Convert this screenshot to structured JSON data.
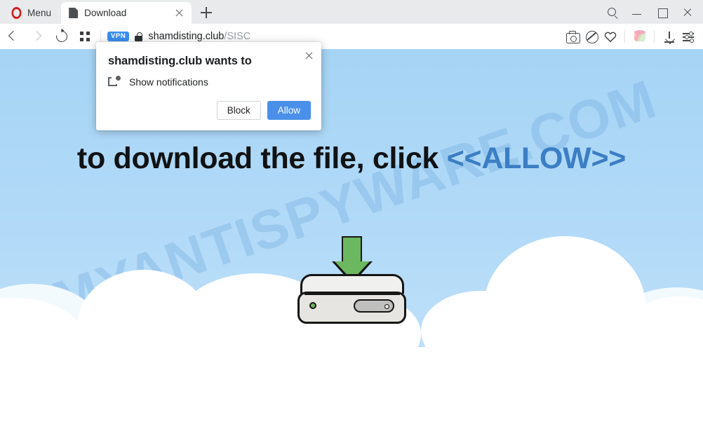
{
  "browser": {
    "menu_label": "Menu",
    "opera_logo_icon": "opera-logo-icon",
    "tab": {
      "title": "Download",
      "favicon": "page-icon",
      "close_icon": "close-icon"
    },
    "new_tab_icon": "plus-icon",
    "window_controls": {
      "search_icon": "search-icon",
      "minimize_icon": "minimize-icon",
      "maximize_icon": "maximize-icon",
      "close_icon": "close-icon"
    },
    "nav": {
      "back_icon": "chevron-left-icon",
      "forward_icon": "chevron-right-icon",
      "reload_icon": "reload-icon",
      "speed_dial_icon": "grid-icon"
    },
    "address": {
      "vpn_badge": "VPN",
      "lock_icon": "lock-icon",
      "domain": "shamdisting.club",
      "path": "/SISC"
    },
    "toolbar_icons": [
      "camera-icon",
      "ad-blocker-icon",
      "heart-icon",
      "player-icon",
      "download-icon",
      "easy-setup-icon"
    ]
  },
  "dialog": {
    "title": "shamdisting.club wants to",
    "permission_icon": "notification-icon",
    "permission_label": "Show notifications",
    "close_icon": "close-icon",
    "block_label": "Block",
    "allow_label": "Allow",
    "allow_color": "#4a90ea"
  },
  "page": {
    "headline_prefix": "to download the file, click ",
    "headline_allow": "<<ALLOW>>",
    "headline_allow_color": "#3b7ec4",
    "watermark": "MYANTISPYWARE.COM",
    "sky_color": "#a9d6f6",
    "cloud_color": "#ffffff",
    "drive_icon": "hard-drive-download-icon",
    "arrow_color": "#6cb860"
  }
}
